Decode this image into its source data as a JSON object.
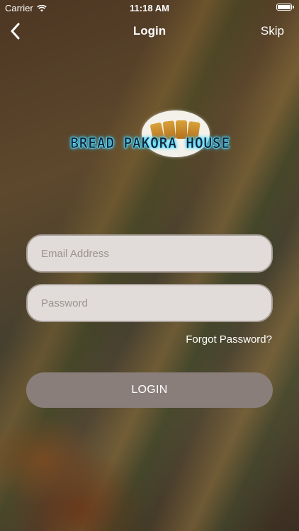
{
  "status_bar": {
    "carrier": "Carrier",
    "time": "11:18 AM"
  },
  "nav": {
    "title": "Login",
    "skip_label": "Skip"
  },
  "logo": {
    "text": "BREAD PAKORA HOUSE"
  },
  "form": {
    "email_placeholder": "Email Address",
    "password_placeholder": "Password",
    "forgot_label": "Forgot Password?",
    "login_label": "LOGIN"
  },
  "colors": {
    "field_bg": "#e1dcd9",
    "button_bg": "#8a7e7a",
    "logo_glow": "#3ad0ff"
  },
  "icons": [
    "wifi-icon",
    "battery-icon",
    "back-chevron-icon"
  ]
}
